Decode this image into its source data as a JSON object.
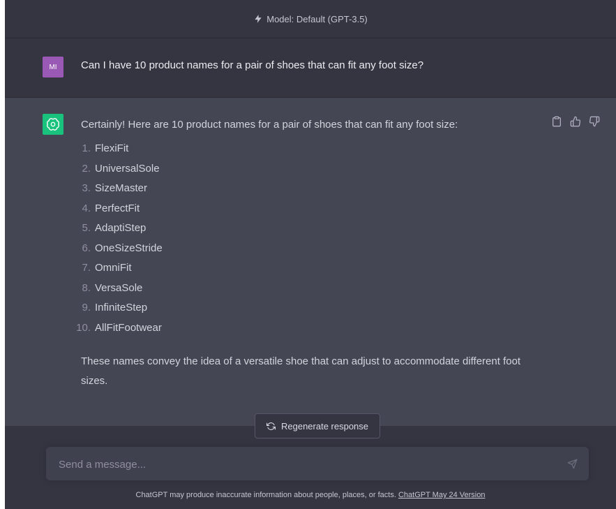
{
  "header": {
    "model_label": "Model: Default (GPT-3.5)"
  },
  "user_message": {
    "avatar_initials": "MI",
    "text": "Can I have 10 product names for a pair of shoes that can fit any foot size?"
  },
  "assistant_message": {
    "intro": "Certainly! Here are 10 product names for a pair of shoes that can fit any foot size:",
    "items": [
      {
        "num": "1.",
        "name": "FlexiFit"
      },
      {
        "num": "2.",
        "name": "UniversalSole"
      },
      {
        "num": "3.",
        "name": "SizeMaster"
      },
      {
        "num": "4.",
        "name": "PerfectFit"
      },
      {
        "num": "5.",
        "name": "AdaptiStep"
      },
      {
        "num": "6.",
        "name": "OneSizeStride"
      },
      {
        "num": "7.",
        "name": "OmniFit"
      },
      {
        "num": "8.",
        "name": "VersaSole"
      },
      {
        "num": "9.",
        "name": "InfiniteStep"
      },
      {
        "num": "10.",
        "name": "AllFitFootwear"
      }
    ],
    "outro": "These names convey the idea of a versatile shoe that can adjust to accommodate different foot sizes."
  },
  "actions": {
    "icons": [
      "clipboard-icon",
      "thumbs-up-icon",
      "thumbs-down-icon"
    ]
  },
  "composer": {
    "regenerate_label": "Regenerate response",
    "placeholder": "Send a message..."
  },
  "footer": {
    "disclaimer": "ChatGPT may produce inaccurate information about people, places, or facts.",
    "version_link": "ChatGPT May 24 Version"
  },
  "colors": {
    "background": "#343541",
    "assistant_bg": "#444654",
    "bot_avatar": "#19c37d",
    "user_avatar": "#9b59b6",
    "input_bg": "#40414f"
  }
}
